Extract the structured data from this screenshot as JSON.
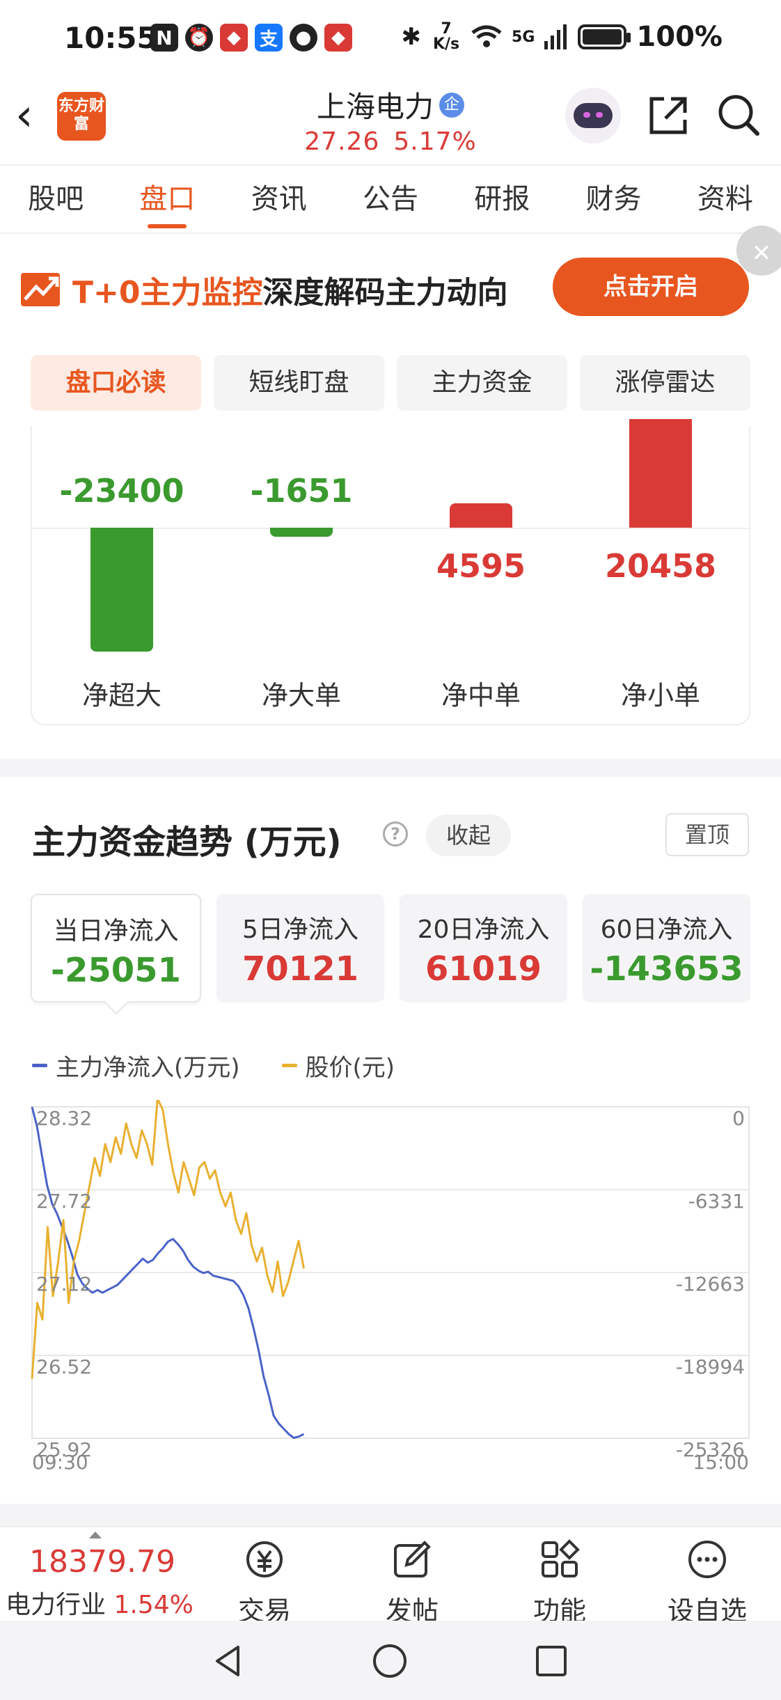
{
  "status_bar": {
    "time": "10:55",
    "net_speed": "7 K/s",
    "network": "5G",
    "battery": "100%"
  },
  "header": {
    "logo_text": "东方财富",
    "stock_name": "上海电力",
    "badge": "企",
    "price": "27.26",
    "change_pct": "5.17%"
  },
  "tabs": [
    "股吧",
    "盘口",
    "资讯",
    "公告",
    "研报",
    "财务",
    "资料"
  ],
  "banner": {
    "highlight": "T+0主力监控",
    "text": "深度解码主力动向",
    "button": "点击开启"
  },
  "sub_tabs": [
    "盘口必读",
    "短线盯盘",
    "主力资金",
    "涨停雷达"
  ],
  "net_flow_bars": {
    "chart_data": {
      "type": "bar",
      "categories": [
        "净超大",
        "净大单",
        "净中单",
        "净小单"
      ],
      "values": [
        -23400,
        -1651,
        4595,
        20458
      ],
      "value_labels": [
        "-23400",
        "-1651",
        "4595",
        "20458"
      ]
    }
  },
  "trend": {
    "title": "主力资金趋势 (万元)",
    "collapse_label": "收起",
    "pin_label": "置顶",
    "cards": [
      {
        "label": "当日净流入",
        "value": "-25051",
        "color": "#3a9a2e"
      },
      {
        "label": "5日净流入",
        "value": "70121",
        "color": "#d93a36"
      },
      {
        "label": "20日净流入",
        "value": "61019",
        "color": "#d93a36"
      },
      {
        "label": "60日净流入",
        "value": "-143653",
        "color": "#3a9a2e"
      }
    ],
    "legend": [
      {
        "name": "主力净流入(万元)",
        "color": "#4a62c8"
      },
      {
        "name": "股价(元)",
        "color": "#e8b030"
      }
    ],
    "chart_data": {
      "type": "line",
      "x_start": "09:30",
      "x_end": "15:00",
      "left_axis_ticks": [
        "28.32",
        "27.72",
        "27.12",
        "26.52",
        "25.92"
      ],
      "right_axis_ticks": [
        "0",
        "-6331",
        "-12663",
        "-18994",
        "-25326"
      ],
      "series": [
        {
          "name": "主力净流入(万元)",
          "axis": "right",
          "color": "#4a62c8",
          "values": [
            0,
            -1500,
            -3800,
            -6000,
            -7400,
            -8200,
            -9200,
            -10200,
            -11400,
            -12800,
            -13500,
            -13900,
            -14200,
            -14000,
            -14200,
            -14000,
            -13800,
            -13600,
            -13200,
            -12800,
            -12400,
            -12000,
            -11600,
            -11900,
            -11700,
            -11200,
            -10800,
            -10300,
            -10100,
            -10500,
            -11000,
            -11700,
            -12200,
            -12500,
            -12700,
            -12600,
            -12900,
            -13000,
            -13100,
            -13200,
            -13300,
            -13700,
            -14400,
            -15400,
            -16900,
            -18600,
            -20600,
            -22000,
            -23600,
            -24200,
            -24600,
            -25000,
            -25300,
            -25200,
            -25000
          ]
        },
        {
          "name": "股价(元)",
          "axis": "left",
          "color": "#e8b030",
          "values": [
            26.35,
            26.9,
            26.78,
            27.45,
            26.95,
            27.2,
            27.5,
            26.9,
            27.2,
            27.35,
            27.55,
            27.75,
            27.95,
            27.82,
            28.05,
            27.92,
            28.1,
            27.98,
            28.2,
            28.05,
            27.95,
            28.15,
            28.05,
            27.9,
            28.38,
            28.3,
            28.05,
            27.85,
            27.7,
            27.92,
            27.8,
            27.68,
            27.88,
            27.92,
            27.8,
            27.86,
            27.7,
            27.6,
            27.7,
            27.5,
            27.4,
            27.55,
            27.32,
            27.2,
            27.3,
            27.1,
            26.98,
            27.2,
            26.95,
            27.05,
            27.2,
            27.35,
            27.15
          ]
        }
      ]
    }
  },
  "bottom_bar": {
    "index_value": "18379.79",
    "index_name": "电力行业",
    "index_change": "1.54%",
    "tools": [
      "交易",
      "发帖",
      "功能",
      "设自选"
    ]
  },
  "colors": {
    "accent": "#e8561f",
    "up": "#d93a36",
    "down": "#3a9a2e"
  }
}
